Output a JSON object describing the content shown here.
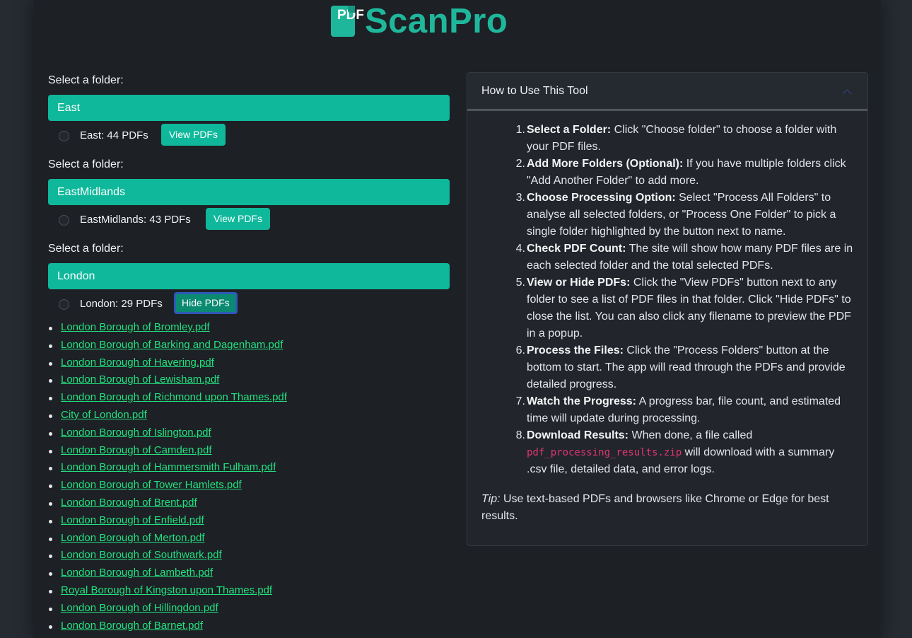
{
  "logo": {
    "badge": "PDF",
    "name": "ScanPro"
  },
  "folders": [
    {
      "label": "Select a folder:",
      "name": "East",
      "count_text": "East: 44 PDFs",
      "button": "View PDFs"
    },
    {
      "label": "Select a folder:",
      "name": "EastMidlands",
      "count_text": "EastMidlands: 43 PDFs",
      "button": "View PDFs"
    },
    {
      "label": "Select a folder:",
      "name": "London",
      "count_text": "London: 29 PDFs",
      "button": "Hide PDFs"
    }
  ],
  "pdf_files": [
    "London Borough of Bromley.pdf",
    "London Borough of Barking and Dagenham.pdf",
    "London Borough of Havering.pdf",
    "London Borough of Lewisham.pdf",
    "London Borough of Richmond upon Thames.pdf",
    "City of London.pdf",
    "London Borough of Islington.pdf",
    "London Borough of Camden.pdf",
    "London Borough of Hammersmith Fulham.pdf",
    "London Borough of Tower Hamlets.pdf",
    "London Borough of Brent.pdf",
    "London Borough of Enfield.pdf",
    "London Borough of Merton.pdf",
    "London Borough of Southwark.pdf",
    "London Borough of Lambeth.pdf",
    "Royal Borough of Kingston upon Thames.pdf",
    "London Borough of Hillingdon.pdf",
    "London Borough of Barnet.pdf"
  ],
  "help": {
    "title": "How to Use This Tool",
    "steps": [
      {
        "num": "1.",
        "bold": "Select a Folder:",
        "text": " Click \"Choose folder\" to choose a folder with your PDF files."
      },
      {
        "num": "2.",
        "bold": "Add More Folders (Optional):",
        "text": " If you have multiple folders click \"Add Another Folder\" to add more."
      },
      {
        "num": "3.",
        "bold": "Choose Processing Option:",
        "text": " Select \"Process All Folders\" to analyse all selected folders, or \"Process One Folder\" to pick a single folder highlighted by the button next to name."
      },
      {
        "num": "4.",
        "bold": "Check PDF Count:",
        "text": " The site will show how many PDF files are in each selected folder and the total selected PDFs."
      },
      {
        "num": "5.",
        "bold": "View or Hide PDFs:",
        "text": " Click the \"View PDFs\" button next to any folder to see a list of PDF files in that folder. Click \"Hide PDFs\" to close the list. You can also click any filename to preview the PDF in a popup."
      },
      {
        "num": "6.",
        "bold": "Process the Files:",
        "text": " Click the \"Process Folders\" button at the bottom to start. The app will read through the PDFs and provide detailed progress."
      },
      {
        "num": "7.",
        "bold": "Watch the Progress:",
        "text": " A progress bar, file count, and estimated time will update during processing."
      },
      {
        "num": "8.",
        "bold": "Download Results:",
        "text": " When done, a file called ",
        "code": "pdf_processing_results.zip",
        "text_after": " will download with a summary .csv file, detailed data, and error logs."
      }
    ],
    "tip_label": "Tip:",
    "tip_text": " Use text-based PDFs and browsers like Chrome or Edge for best results."
  }
}
